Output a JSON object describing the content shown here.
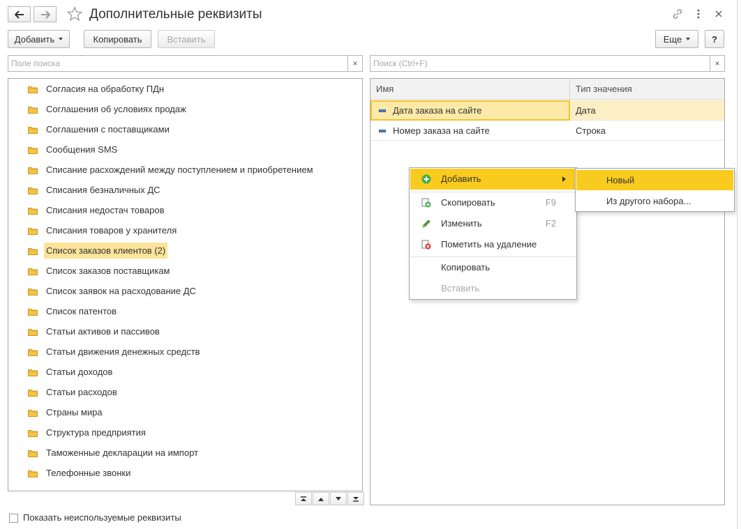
{
  "window": {
    "title": "Дополнительные реквизиты"
  },
  "icons": {
    "back": "arrow-left-icon",
    "forward": "arrow-right-icon",
    "favorite": "star-icon",
    "link": "link-icon",
    "more": "kebab-menu-icon",
    "close": "close-icon"
  },
  "toolbar": {
    "add_label": "Добавить",
    "copy_label": "Копировать",
    "paste_label": "Вставить",
    "more_label": "Еще",
    "help_label": "?"
  },
  "left_search": {
    "placeholder": "Поле поиска",
    "clear_label": "×"
  },
  "right_search": {
    "placeholder": "Поиск (Ctrl+F)",
    "clear_label": "×"
  },
  "tree": {
    "items": [
      {
        "label": "Согласия на обработку ПДн"
      },
      {
        "label": "Соглашения об условиях продаж"
      },
      {
        "label": "Соглашения с поставщиками"
      },
      {
        "label": "Сообщения SMS"
      },
      {
        "label": "Списание расхождений между поступлением и приобретением"
      },
      {
        "label": "Списания безналичных ДС"
      },
      {
        "label": "Списания недостач товаров"
      },
      {
        "label": "Списания товаров у хранителя"
      },
      {
        "label": "Список заказов клиентов (2)",
        "selected": true
      },
      {
        "label": "Список заказов поставщикам"
      },
      {
        "label": "Список заявок на расходование ДС"
      },
      {
        "label": "Список патентов"
      },
      {
        "label": "Статьи активов и пассивов"
      },
      {
        "label": "Статьи движения денежных средств"
      },
      {
        "label": "Статьи доходов"
      },
      {
        "label": "Статьи расходов"
      },
      {
        "label": "Страны мира"
      },
      {
        "label": "Структура предприятия"
      },
      {
        "label": "Таможенные декларации на импорт"
      },
      {
        "label": "Телефонные звонки"
      }
    ]
  },
  "table": {
    "columns": [
      "Имя",
      "Тип значения"
    ],
    "rows": [
      {
        "name": "Дата заказа на сайте",
        "type": "Дата",
        "selected": true
      },
      {
        "name": "Номер заказа на сайте",
        "type": "Строка"
      }
    ]
  },
  "context_menu": {
    "items": [
      {
        "label": "Добавить",
        "shortcut": "",
        "icon": "add-circle-icon",
        "active": true,
        "has_submenu": true
      },
      {
        "label": "Скопировать",
        "shortcut": "F9",
        "icon": "copy-icon"
      },
      {
        "label": "Изменить",
        "shortcut": "F2",
        "icon": "pencil-icon"
      },
      {
        "label": "Пометить на удаление",
        "shortcut": "",
        "icon": "delete-mark-icon"
      },
      {
        "label": "Копировать",
        "shortcut": ""
      },
      {
        "label": "Вставить",
        "shortcut": "",
        "disabled": true
      }
    ]
  },
  "submenu": {
    "items": [
      {
        "label": "Новый",
        "active": true
      },
      {
        "label": "Из другого набора..."
      }
    ]
  },
  "footer": {
    "show_unused_label": "Показать неиспользуемые реквизиты",
    "show_unused_checked": false
  },
  "colors": {
    "selection": "#fbe49a",
    "menu_highlight": "#f9cb1e",
    "folder": "#f5c542"
  }
}
